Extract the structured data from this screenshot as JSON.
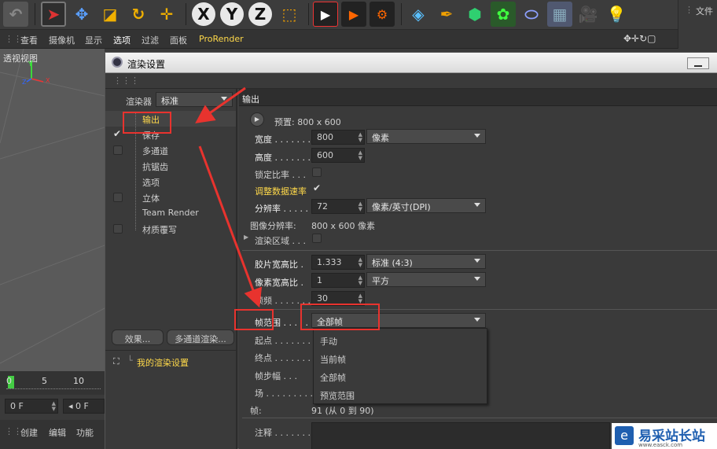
{
  "menu": [
    "查看",
    "摄像机",
    "显示",
    "选项",
    "过滤",
    "面板",
    "ProRender"
  ],
  "file_panel_label": "文件",
  "viewport_label": "透视视图",
  "axes": {
    "y": "Y",
    "x": "X",
    "z": "Z"
  },
  "timeline": {
    "ticks": [
      "0",
      "5",
      "10"
    ],
    "fields": [
      "0 F",
      "0 F"
    ]
  },
  "bottom_menu": [
    "创建",
    "编辑",
    "功能"
  ],
  "dialog": {
    "title": "渲染设置",
    "renderer_label": "渲染器",
    "renderer_value": "标准",
    "tree": [
      {
        "label": "输出",
        "checkbox": false,
        "checked": false
      },
      {
        "label": "保存",
        "checkbox": true,
        "checked": true
      },
      {
        "label": "多通道",
        "checkbox": true,
        "checked": false
      },
      {
        "label": "抗锯齿",
        "checkbox": false,
        "checked": false
      },
      {
        "label": "选项",
        "checkbox": false,
        "checked": false
      },
      {
        "label": "立体",
        "checkbox": true,
        "checked": false
      },
      {
        "label": "Team Render",
        "checkbox": false,
        "checked": false
      },
      {
        "label": "材质覆写",
        "checkbox": true,
        "checked": false
      }
    ],
    "effects_button": "效果...",
    "multipass_button": "多通道渲染...",
    "render_setting_item": "我的渲染设置",
    "section_title": "输出",
    "preset": "预置: 800 x 600",
    "width_label": "宽度",
    "width_value": "800",
    "width_unit": "像素",
    "height_label": "高度",
    "height_value": "600",
    "lock_ratio_label": "锁定比率",
    "adjust_rate_label": "调整数据速率",
    "resolution_label": "分辨率",
    "resolution_value": "72",
    "resolution_unit": "像素/英寸(DPI)",
    "image_res_label": "图像分辨率:",
    "image_res_value": "800 x 600 像素",
    "render_region_label": "渲染区域",
    "film_ratio_label": "胶片宽高比",
    "film_ratio_value": "1.333",
    "film_ratio_preset": "标准 (4:3)",
    "pixel_ratio_label": "像素宽高比",
    "pixel_ratio_value": "1",
    "pixel_ratio_preset": "平方",
    "fps_label": "帧频",
    "fps_value": "30",
    "frame_range_label": "帧范围",
    "frame_range_value": "全部帧",
    "start_label": "起点",
    "end_label": "终点",
    "step_label": "帧步幅",
    "field_label": "场",
    "frames_label": "帧:",
    "frames_value": "91 (从 0 到 90)",
    "notes_label": "注释",
    "frame_range_options": [
      "手动",
      "当前帧",
      "全部帧",
      "预览范围"
    ]
  },
  "watermark": {
    "title": "易采站长站",
    "url": "www.easck.com"
  }
}
